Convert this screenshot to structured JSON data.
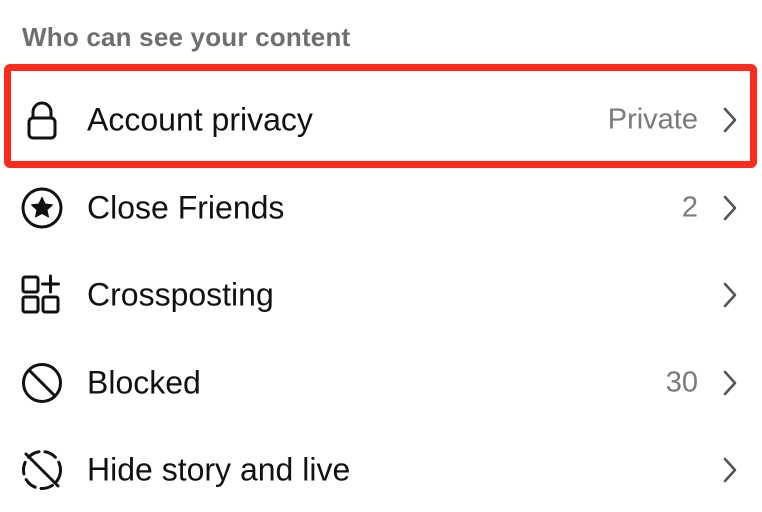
{
  "section": {
    "title": "Who can see your content"
  },
  "rows": [
    {
      "label": "Account privacy",
      "value": "Private",
      "icon": "lock-icon"
    },
    {
      "label": "Close Friends",
      "value": "2",
      "icon": "star-circle-icon"
    },
    {
      "label": "Crossposting",
      "value": "",
      "icon": "crossposting-icon"
    },
    {
      "label": "Blocked",
      "value": "30",
      "icon": "blocked-icon"
    },
    {
      "label": "Hide story and live",
      "value": "",
      "icon": "hide-story-icon"
    }
  ],
  "colors": {
    "highlight_border": "#ff2b1c",
    "header_text": "#6f6f6f",
    "value_text": "#7a7a7a",
    "label_text": "#111111"
  }
}
